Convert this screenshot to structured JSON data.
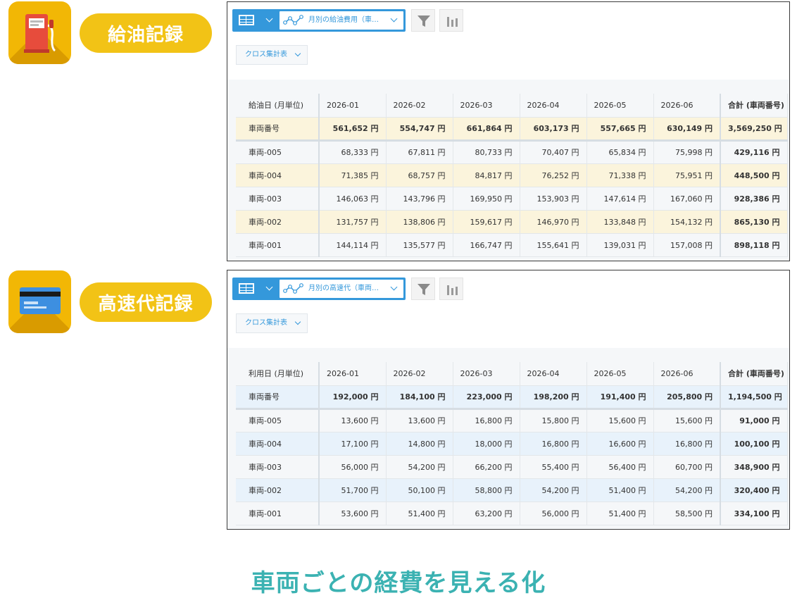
{
  "records": [
    {
      "label": "給油記録",
      "icon": "fuel-pump-icon",
      "graph_name": "月別の給油費用（車…",
      "view_type": "クロス集計表",
      "row_color": "#fbf4dc",
      "alt_color": "#f5f7f9",
      "header": [
        "給油日 (月単位)",
        "2026-01",
        "2026-02",
        "2026-03",
        "2026-04",
        "2026-05",
        "2026-06",
        "合計 (車両番号)"
      ],
      "summary_row": [
        "車両番号",
        "561,652 円",
        "554,747 円",
        "661,864 円",
        "603,173 円",
        "557,665 円",
        "630,149 円",
        "3,569,250 円"
      ],
      "rows": [
        [
          "車両-005",
          "68,333 円",
          "67,811 円",
          "80,733 円",
          "70,407 円",
          "65,834 円",
          "75,998 円",
          "429,116 円"
        ],
        [
          "車両-004",
          "71,385 円",
          "68,757 円",
          "84,817 円",
          "76,252 円",
          "71,338 円",
          "75,951 円",
          "448,500 円"
        ],
        [
          "車両-003",
          "146,063 円",
          "143,796 円",
          "169,950 円",
          "153,903 円",
          "147,614 円",
          "167,060 円",
          "928,386 円"
        ],
        [
          "車両-002",
          "131,757 円",
          "138,806 円",
          "159,617 円",
          "146,970 円",
          "133,848 円",
          "154,132 円",
          "865,130 円"
        ],
        [
          "車両-001",
          "144,114 円",
          "135,577 円",
          "166,747 円",
          "155,641 円",
          "139,031 円",
          "157,008 円",
          "898,118 円"
        ]
      ]
    },
    {
      "label": "高速代記録",
      "icon": "credit-card-icon",
      "graph_name": "月別の高速代（車両…",
      "view_type": "クロス集計表",
      "row_color": "#e8f2fb",
      "alt_color": "#f5f7f9",
      "header": [
        "利用日 (月単位)",
        "2026-01",
        "2026-02",
        "2026-03",
        "2026-04",
        "2026-05",
        "2026-06",
        "合計 (車両番号)"
      ],
      "summary_row": [
        "車両番号",
        "192,000 円",
        "184,100 円",
        "223,000 円",
        "198,200 円",
        "191,400 円",
        "205,800 円",
        "1,194,500 円"
      ],
      "rows": [
        [
          "車両-005",
          "13,600 円",
          "13,600 円",
          "16,800 円",
          "15,800 円",
          "15,600 円",
          "15,600 円",
          "91,000 円"
        ],
        [
          "車両-004",
          "17,100 円",
          "14,800 円",
          "18,000 円",
          "16,800 円",
          "16,600 円",
          "16,800 円",
          "100,100 円"
        ],
        [
          "車両-003",
          "56,000 円",
          "54,200 円",
          "66,200 円",
          "55,400 円",
          "56,400 円",
          "60,700 円",
          "348,900 円"
        ],
        [
          "車両-002",
          "51,700 円",
          "50,100 円",
          "58,800 円",
          "54,200 円",
          "51,400 円",
          "54,200 円",
          "320,400 円"
        ],
        [
          "車両-001",
          "53,600 円",
          "51,400 円",
          "63,200 円",
          "56,000 円",
          "51,400 円",
          "58,500 円",
          "334,100 円"
        ]
      ]
    }
  ],
  "caption": "車両ごとの経費を見える化"
}
